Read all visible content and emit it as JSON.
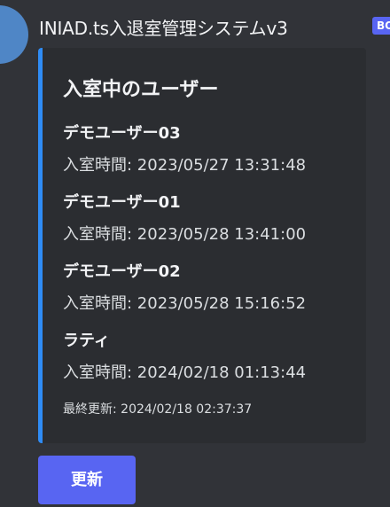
{
  "message": {
    "bot_name": "INIAD.ts入退室管理システムv3",
    "bot_badge": "BOT"
  },
  "embed": {
    "accent_color": "#2f8cf5",
    "title": "入室中のユーザー",
    "users": [
      {
        "name": "デモユーザー03",
        "value": "入室時間: 2023/05/27 13:31:48"
      },
      {
        "name": "デモユーザー01",
        "value": "入室時間: 2023/05/28 13:41:00"
      },
      {
        "name": "デモユーザー02",
        "value": "入室時間: 2023/05/28 15:16:52"
      },
      {
        "name": "ラティ",
        "value": "入室時間: 2024/02/18 01:13:44"
      }
    ],
    "footer": "最終更新: 2024/02/18 02:37:37"
  },
  "button": {
    "label": "更新",
    "color": "#5865f2"
  }
}
